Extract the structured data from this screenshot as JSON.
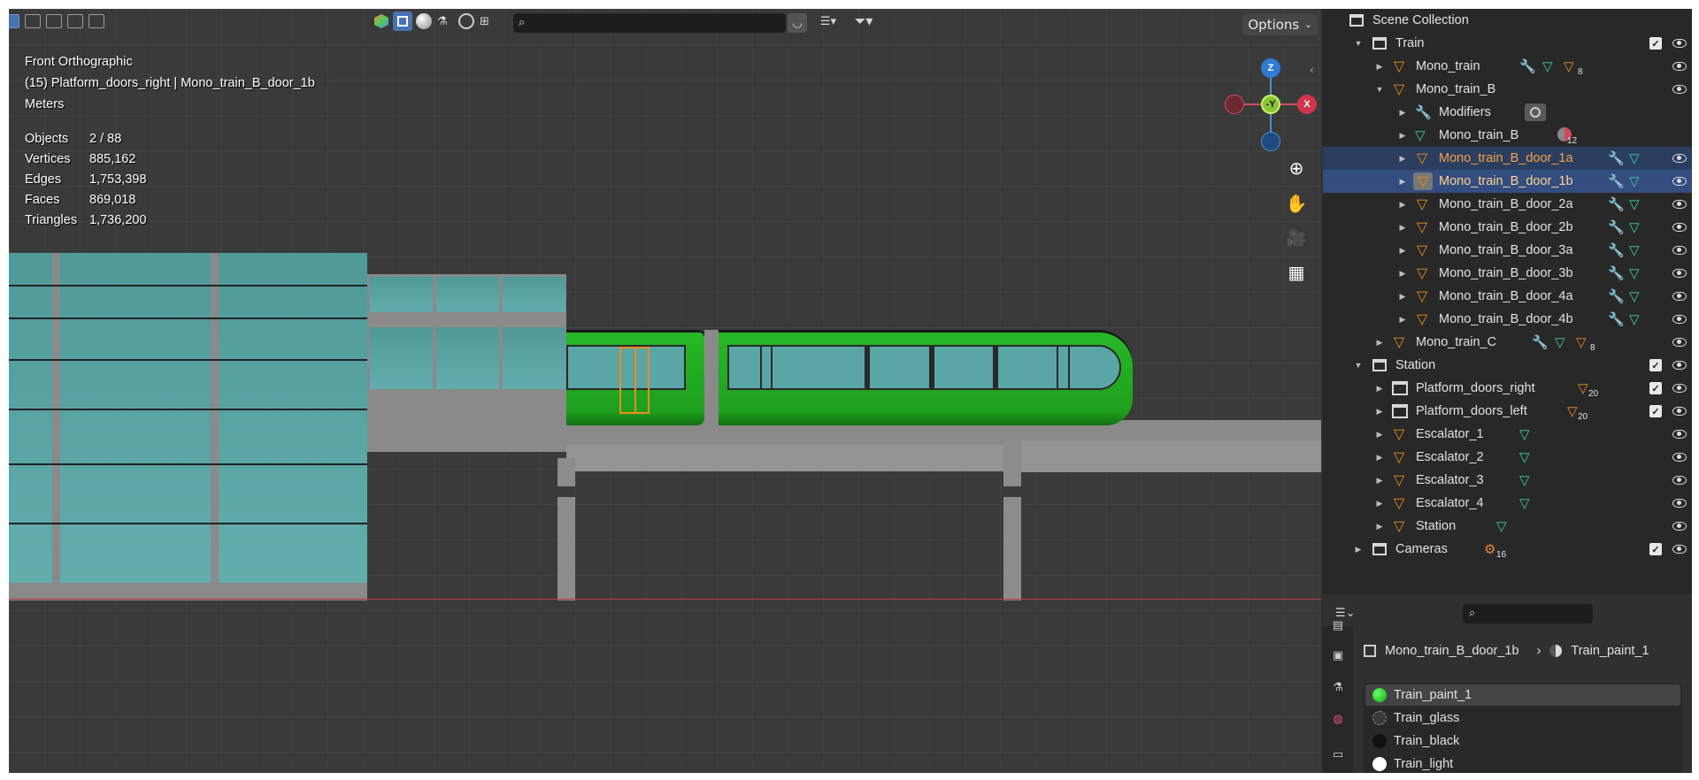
{
  "viewport": {
    "header": {
      "options_label": "Options",
      "search_value": ""
    },
    "info": {
      "view_name": "Front Orthographic",
      "active_object": "(15) Platform_doors_right | Mono_train_B_door_1b",
      "units": "Meters"
    },
    "stats": [
      {
        "label": "Objects",
        "value": "2 / 88"
      },
      {
        "label": "Vertices",
        "value": "885,162"
      },
      {
        "label": "Edges",
        "value": "1,753,398"
      },
      {
        "label": "Faces",
        "value": "869,018"
      },
      {
        "label": "Triangles",
        "value": "1,736,200"
      }
    ],
    "gizmo": {
      "z": "Z",
      "y": "-Y",
      "x": "X"
    },
    "colors": {
      "train_green": "#22b322",
      "glass": "#5aa6a6",
      "selection": "#f08c1a"
    }
  },
  "outliner": {
    "root": "Scene Collection",
    "rows": [
      {
        "label": "Train",
        "type": "collection"
      },
      {
        "label": "Mono_train",
        "type": "object",
        "badge": "8"
      },
      {
        "label": "Mono_train_B",
        "type": "object"
      },
      {
        "label": "Modifiers",
        "type": "modifiers"
      },
      {
        "label": "Mono_train_B",
        "type": "mesh",
        "badge": "12"
      },
      {
        "label": "Mono_train_B_door_1a",
        "type": "object",
        "state": "selected"
      },
      {
        "label": "Mono_train_B_door_1b",
        "type": "object",
        "state": "active"
      },
      {
        "label": "Mono_train_B_door_2a",
        "type": "object"
      },
      {
        "label": "Mono_train_B_door_2b",
        "type": "object"
      },
      {
        "label": "Mono_train_B_door_3a",
        "type": "object"
      },
      {
        "label": "Mono_train_B_door_3b",
        "type": "object"
      },
      {
        "label": "Mono_train_B_door_4a",
        "type": "object"
      },
      {
        "label": "Mono_train_B_door_4b",
        "type": "object"
      },
      {
        "label": "Mono_train_C",
        "type": "object",
        "badge": "8"
      },
      {
        "label": "Station",
        "type": "collection"
      },
      {
        "label": "Platform_doors_right",
        "type": "empty",
        "badge": "20"
      },
      {
        "label": "Platform_doors_left",
        "type": "empty",
        "badge": "20"
      },
      {
        "label": "Escalator_1",
        "type": "object"
      },
      {
        "label": "Escalator_2",
        "type": "object"
      },
      {
        "label": "Escalator_3",
        "type": "object"
      },
      {
        "label": "Escalator_4",
        "type": "object"
      },
      {
        "label": "Station",
        "type": "object"
      },
      {
        "label": "Cameras",
        "type": "collection",
        "badge": "16"
      }
    ]
  },
  "properties": {
    "search_value": "",
    "breadcrumb_object": "Mono_train_B_door_1b",
    "breadcrumb_sep": "›",
    "breadcrumb_material": "Train_paint_1",
    "materials": [
      {
        "name": "Train_paint_1",
        "color": "#22cc22"
      },
      {
        "name": "Train_glass",
        "color": "#3a3a3a"
      },
      {
        "name": "Train_black",
        "color": "#111111"
      },
      {
        "name": "Train_light",
        "color": "#ffffff"
      }
    ]
  }
}
